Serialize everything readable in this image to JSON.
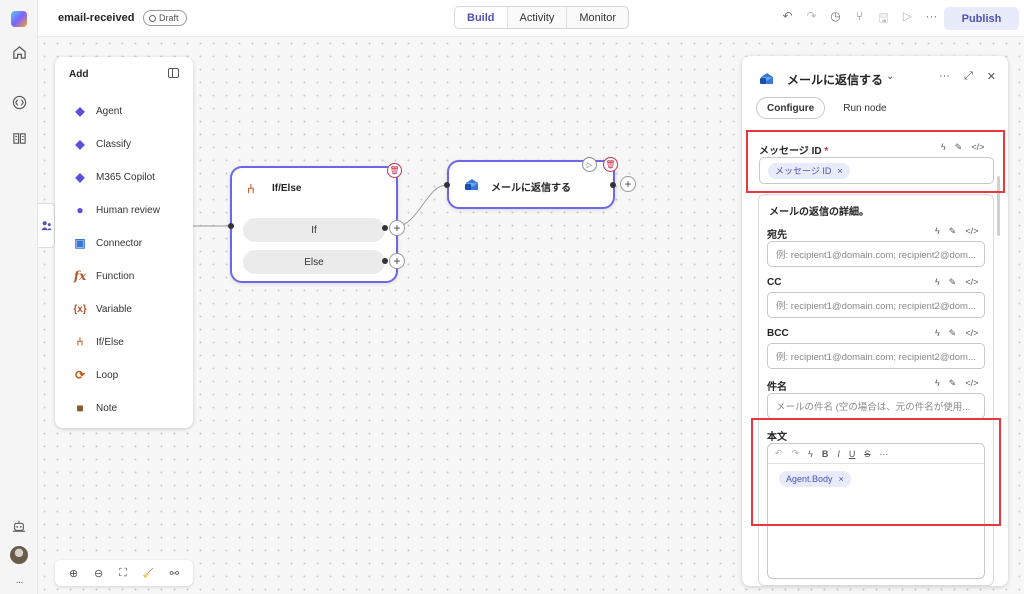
{
  "rail": {
    "icons": [
      "app-logo-icon",
      "home-icon",
      "code-icon",
      "library-icon",
      "robot-icon",
      "avatar",
      "more-icon"
    ],
    "more_glyph": "···"
  },
  "topbar": {
    "flow_name": "email-received",
    "status": "Draft",
    "tabs": [
      {
        "label": "Build",
        "active": true
      },
      {
        "label": "Activity",
        "active": false
      },
      {
        "label": "Monitor",
        "active": false
      }
    ],
    "toolbar_icons": [
      "undo-icon",
      "redo-icon",
      "history-icon",
      "share-icon",
      "save-icon",
      "run-icon",
      "more-icon"
    ],
    "toolbar_glyphs": {
      "undo": "↶",
      "redo": "↷",
      "history": "◷",
      "share": "⑂",
      "save": "🖫",
      "run": "▷",
      "more": "···"
    },
    "publish_label": "Publish"
  },
  "add_panel": {
    "title": "Add",
    "items": [
      {
        "label": "Agent",
        "icon": "agent-icon",
        "glyph": "◆",
        "color": "#5b4fe0"
      },
      {
        "label": "Classify",
        "icon": "classify-icon",
        "glyph": "◆",
        "color": "#5b4fe0"
      },
      {
        "label": "M365 Copilot",
        "icon": "copilot-icon",
        "glyph": "◆",
        "color": "#5b4fe0"
      },
      {
        "label": "Human review",
        "icon": "human-review-icon",
        "glyph": "●",
        "color": "#5b4fe0"
      },
      {
        "label": "Connector",
        "icon": "connector-icon",
        "glyph": "▣",
        "color": "#3a78d8"
      },
      {
        "label": "Function",
        "icon": "function-icon",
        "glyph": "fx",
        "color": "#b4552a"
      },
      {
        "label": "Variable",
        "icon": "variable-icon",
        "glyph": "{x}",
        "color": "#b4552a"
      },
      {
        "label": "If/Else",
        "icon": "branch-icon",
        "glyph": "⑃",
        "color": "#c4581c"
      },
      {
        "label": "Loop",
        "icon": "loop-icon",
        "glyph": "⟳",
        "color": "#c4581c"
      },
      {
        "label": "Note",
        "icon": "note-icon",
        "glyph": "■",
        "color": "#8a5a2b"
      }
    ]
  },
  "zoom_controls": {
    "icons": [
      "zoom-in-icon",
      "zoom-out-icon",
      "fit-view-icon",
      "clean-up-icon",
      "share-graph-icon"
    ],
    "glyphs": [
      "⊕",
      "⊖",
      "⛶",
      "🧹",
      "⚯"
    ]
  },
  "nodes": {
    "ifelse": {
      "title": "If/Else",
      "branches": [
        "If",
        "Else"
      ],
      "icon_glyph": "⑃"
    },
    "reply": {
      "title": "メールに返信する"
    },
    "glyphs": {
      "trash": "🗑",
      "play": "▷",
      "plus": "+"
    }
  },
  "right_panel": {
    "title": "メールに返信する",
    "chevron": "⌄",
    "action_glyphs": {
      "more": "···",
      "expand": "⤢",
      "close": "✕"
    },
    "tabs": [
      {
        "label": "Configure",
        "active": true
      },
      {
        "label": "Run node",
        "active": false
      }
    ],
    "field_icon_glyphs": {
      "bolt": "ϟ",
      "pin": "✎",
      "code": "</>"
    },
    "message_id": {
      "label": "メッセージ ID",
      "required": "*",
      "chip": "メッセージ ID",
      "chip_close": "×"
    },
    "details_title": "メールの返信の詳細。",
    "to": {
      "label": "宛先",
      "placeholder": "例: recipient1@domain.com; recipient2@dom..."
    },
    "cc": {
      "label": "CC",
      "placeholder": "例: recipient1@domain.com; recipient2@dom..."
    },
    "bcc": {
      "label": "BCC",
      "placeholder": "例: recipient1@domain.com; recipient2@dom..."
    },
    "subject": {
      "label": "件名",
      "placeholder": "メールの件名 (空の場合は、元の件名が使用..."
    },
    "body": {
      "label": "本文",
      "chip": "Agent.Body",
      "chip_close": "×",
      "tools": [
        "↶",
        "↷",
        "ϟ",
        "B",
        "I",
        "U",
        "S",
        "···"
      ]
    }
  },
  "colors": {
    "accent": "#4f52b2",
    "node_border": "#6b67e6",
    "highlight": "#e8373e",
    "delete": "#c4314b"
  }
}
